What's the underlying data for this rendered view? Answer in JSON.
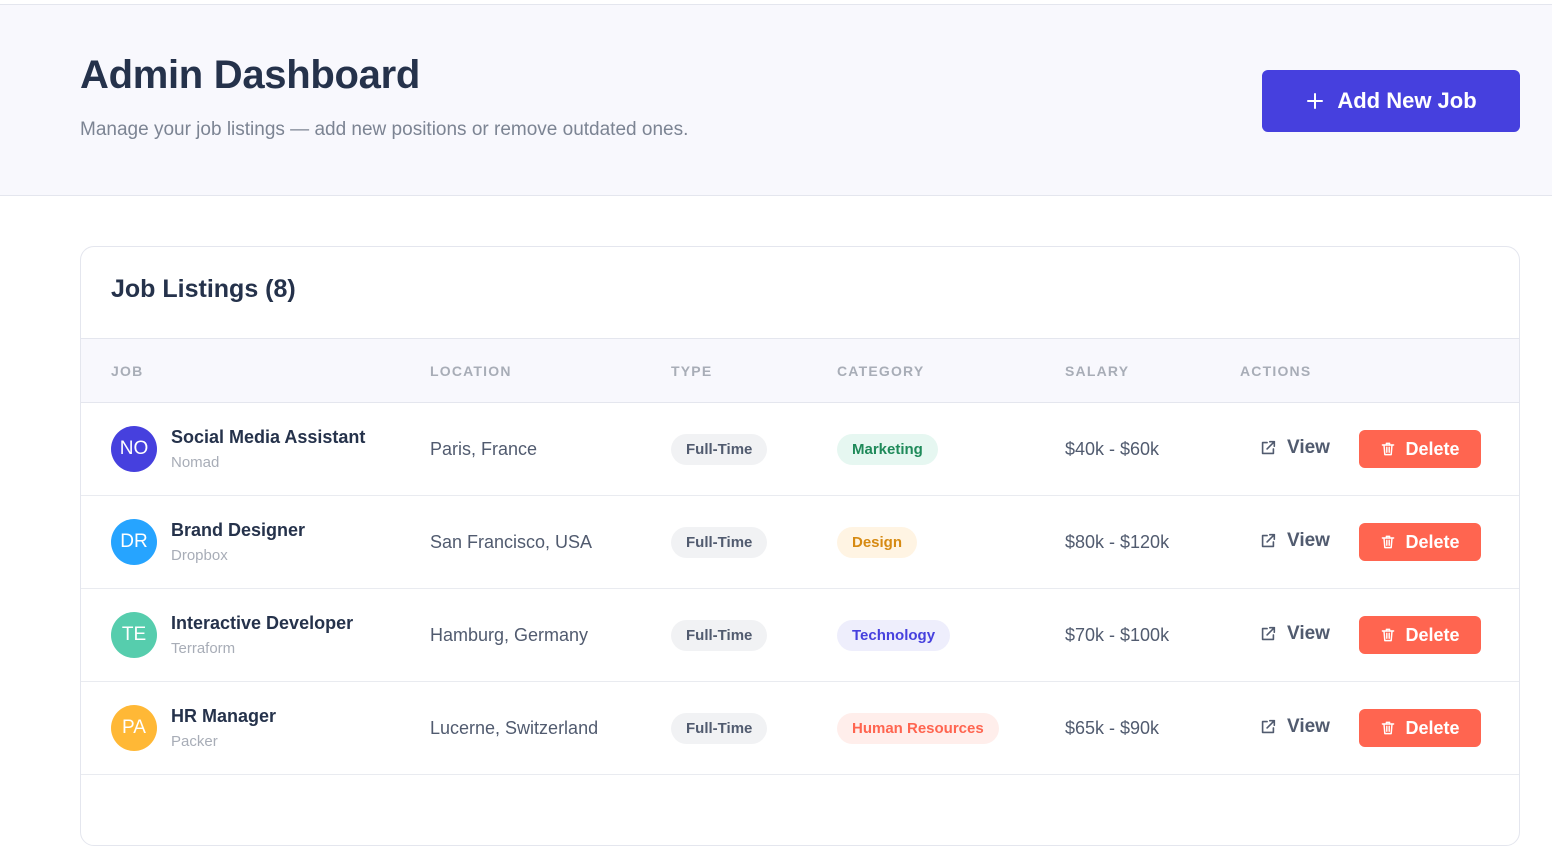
{
  "header": {
    "title": "Admin Dashboard",
    "subtitle": "Manage your job listings — add new positions or remove outdated ones.",
    "add_button_label": "Add New Job",
    "add_button_icon": "plus-icon",
    "background": "#f8f8fd"
  },
  "listings": {
    "title": "Job Listings (8)",
    "columns": [
      "JOB",
      "LOCATION",
      "TYPE",
      "CATEGORY",
      "SALARY",
      "ACTIONS"
    ],
    "view_label": "View",
    "view_icon": "external-link-icon",
    "delete_label": "Delete",
    "delete_icon": "trash-icon",
    "rows": [
      {
        "initials": "NO",
        "avatar_color": "#4640de",
        "title": "Social Media Assistant",
        "company": "Nomad",
        "location": "Paris, France",
        "type": "Full-Time",
        "category": "Marketing",
        "cat_bg": "#e6f7f1",
        "cat_fg": "#1f8a5a",
        "salary": "$40k - $60k"
      },
      {
        "initials": "DR",
        "avatar_color": "#26a4ff",
        "title": "Brand Designer",
        "company": "Dropbox",
        "location": "San Francisco, USA",
        "type": "Full-Time",
        "category": "Design",
        "cat_bg": "#fff4e3",
        "cat_fg": "#d68a12",
        "salary": "$80k - $120k"
      },
      {
        "initials": "TE",
        "avatar_color": "#56cdad",
        "title": "Interactive Developer",
        "company": "Terraform",
        "location": "Hamburg, Germany",
        "type": "Full-Time",
        "category": "Technology",
        "cat_bg": "#eeeefc",
        "cat_fg": "#4640de",
        "salary": "$70k - $100k"
      },
      {
        "initials": "PA",
        "avatar_color": "#ffb836",
        "title": "HR Manager",
        "company": "Packer",
        "location": "Lucerne, Switzerland",
        "type": "Full-Time",
        "category": "Human Resources",
        "cat_bg": "#ffeeeb",
        "cat_fg": "#ff6550",
        "salary": "$65k - $90k"
      }
    ]
  },
  "colors": {
    "primary": "#4640de",
    "danger": "#ff6550",
    "text_dark": "#25324b",
    "text_muted": "#7c8493"
  }
}
